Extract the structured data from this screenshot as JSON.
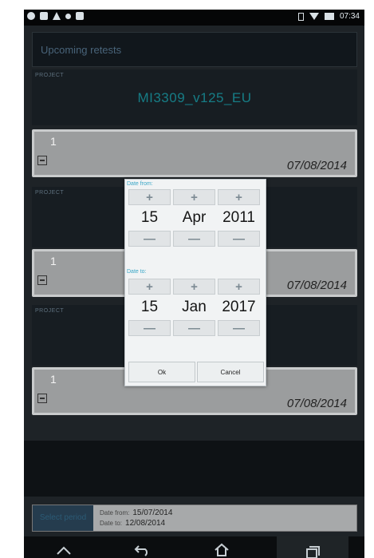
{
  "status_bar": {
    "left_icons": [
      "cloud-icon",
      "mail-icon",
      "warning-icon",
      "recording-icon",
      "image-icon"
    ],
    "right_icons": [
      "sim-icon",
      "wifi-icon",
      "battery-icon"
    ],
    "time": "07:34"
  },
  "header": {
    "title": "Upcoming retests"
  },
  "items": [
    {
      "project_label": "PROJECT",
      "project_name": "MI3309_v125_EU",
      "number": "1",
      "date": "07/08/2014"
    },
    {
      "project_label": "PROJECT",
      "project_name": "",
      "number": "1",
      "date": "07/08/2014"
    },
    {
      "project_label": "PROJECT",
      "project_name": "",
      "number": "1",
      "date": "07/08/2014"
    }
  ],
  "footer": {
    "select_button": "Select period",
    "date_from_label": "Date from:",
    "date_from_value": "15/07/2014",
    "date_to_label": "Date to:",
    "date_to_value": "12/08/2014"
  },
  "dialog": {
    "from_label": "Date from:",
    "from": {
      "day": "15",
      "month": "Apr",
      "year": "2011"
    },
    "to_label": "Date to:",
    "to": {
      "day": "15",
      "month": "Jan",
      "year": "2017"
    },
    "plus": "+",
    "minus": "—",
    "ok_label": "Ok",
    "cancel_label": "Cancel"
  },
  "nav": {
    "icons": [
      "back-chevron-icon",
      "back-icon",
      "home-icon",
      "recent-apps-icon"
    ]
  }
}
